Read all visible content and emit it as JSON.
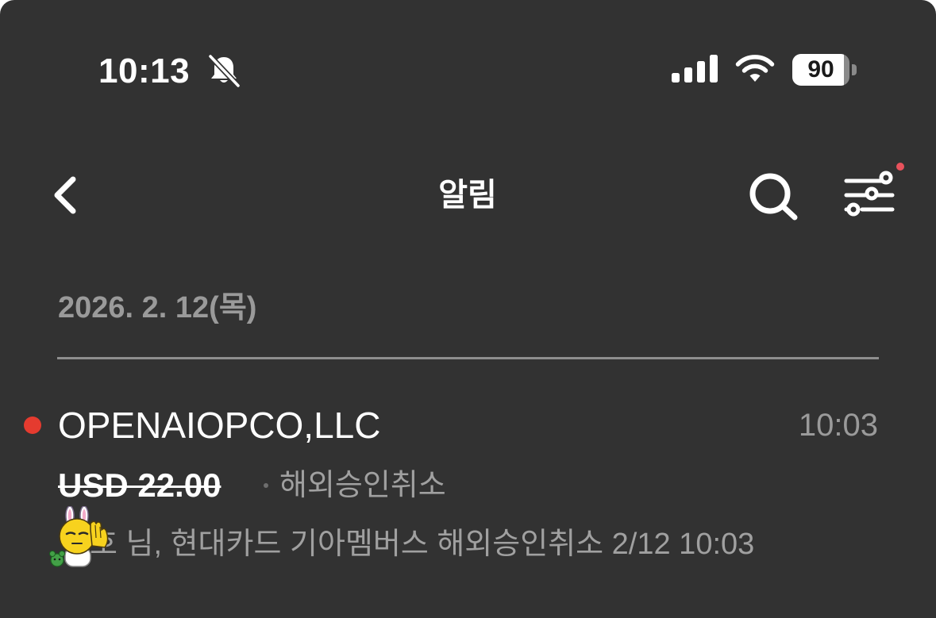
{
  "status_bar": {
    "time": "10:13",
    "battery_percent": "90",
    "battery_level": 0.9
  },
  "nav": {
    "title": "알림"
  },
  "list": {
    "date_header": "2026. 2. 12(목)",
    "items": [
      {
        "merchant": "OPENAIOPCO,LLC",
        "time": "10:03",
        "amount": "USD 22.00",
        "type": "해외승인취소",
        "message": "호 님, 현대카드 기아멤버스 해외승인취소 2/12 10:03",
        "unread": true
      }
    ]
  },
  "colors": {
    "background": "#323232",
    "unread_dot": "#e53b2f",
    "filter_badge": "#e8525c",
    "secondary_text": "#9a9a9a"
  },
  "icons": {
    "status": [
      "bell-off-icon",
      "cellular-signal-icon",
      "wifi-icon",
      "battery-icon"
    ],
    "nav": [
      "back-chevron-icon",
      "search-icon",
      "filter-sliders-icon"
    ]
  }
}
